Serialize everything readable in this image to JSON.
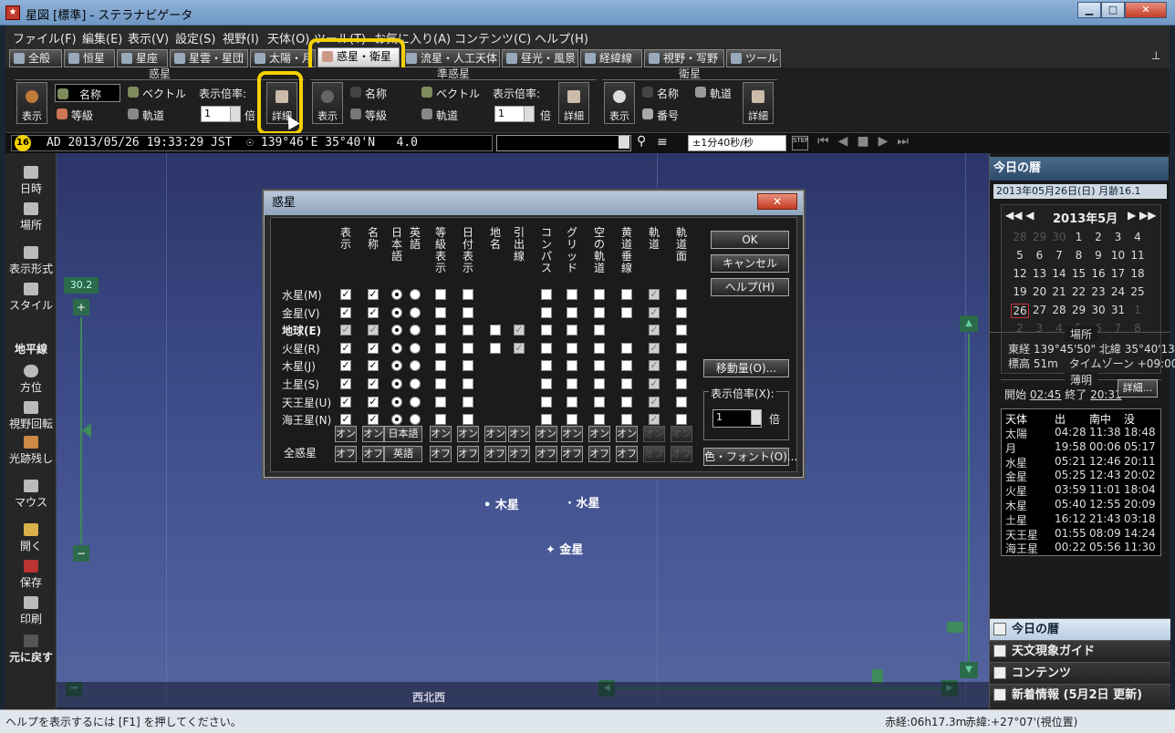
{
  "window": {
    "title": "星図 [標準] - ステラナビゲータ",
    "min": "▁",
    "max": "□",
    "close": "✕"
  },
  "menus": [
    "ファイル(F)",
    "編集(E)",
    "表示(V)",
    "設定(S)",
    "視野(I)",
    "天体(O)",
    "ツール(T)",
    "お気に入り(A)",
    "コンテンツ(C)",
    "ヘルプ(H)"
  ],
  "tabs": [
    "全般",
    "恒星",
    "星座",
    "星雲・星団",
    "太陽・月",
    "惑星・衛星",
    "流星・人工天体",
    "昼光・風景",
    "経緯線",
    "視野・写野",
    "ツール"
  ],
  "toolbar": {
    "planet": {
      "title": "惑星",
      "show": "表示",
      "name": "名称",
      "mag": "等級",
      "vector": "ベクトル",
      "orbit": "軌道",
      "scale_label": "表示倍率:",
      "scale_value": "1",
      "scale_unit": "倍",
      "detail": "詳細"
    },
    "minor": {
      "title": "準惑星",
      "show": "表示",
      "name": "名称",
      "mag": "等級",
      "vector": "ベクトル",
      "orbit": "軌道",
      "scale_label": "表示倍率:",
      "scale_value": "1",
      "scale_unit": "倍",
      "detail": "詳細"
    },
    "satellite": {
      "title": "衛星",
      "show": "表示",
      "name": "名称",
      "orbit": "軌道",
      "number": "番号",
      "detail": "詳細"
    }
  },
  "statusline": {
    "badge": "16",
    "datetime": "AD 2013/05/26 19:33:29 JST",
    "location": "139°46'E 35°40'N",
    "zoom": "4.0",
    "speed": "±1分40秒/秒",
    "step": "STEP"
  },
  "lefttoolbar": [
    "日時",
    "場所",
    "表示形式",
    "スタイル",
    "地平線",
    "方位",
    "視野回転",
    "光跡残し",
    "マウス",
    "開く",
    "保存",
    "印刷",
    "元に戻す"
  ],
  "sky": {
    "fov_value": "30.2",
    "plus": "+",
    "minus": "−",
    "direction": "西北西",
    "planets": [
      "木星",
      "水星",
      "金星"
    ]
  },
  "dialog": {
    "title": "惑星",
    "close": "✕",
    "columns": [
      "表示",
      "名称",
      "日本語",
      "英語",
      "等級表示",
      "日付表示",
      "地名",
      "引出線",
      "コンパス",
      "グリッド",
      "空の軌道",
      "黄道垂線",
      "軌道",
      "軌道面"
    ],
    "rows": [
      "水星(M)",
      "金星(V)",
      "地球(E)",
      "火星(R)",
      "木星(J)",
      "土星(S)",
      "天王星(U)",
      "海王星(N)"
    ],
    "all_label": "全惑星",
    "on": "オン",
    "off": "オフ",
    "on_jp": "日本語",
    "off_en": "英語",
    "ok": "OK",
    "cancel": "キャンセル",
    "help": "ヘルプ(H)",
    "move": "移動量(O)...",
    "scale_group": "表示倍率(X):",
    "scale_value": "1",
    "scale_unit": "倍",
    "colorfont": "色・フォント(O)..."
  },
  "rightpanel": {
    "header": "今日の暦",
    "date": "2013年05月26日(日) 月齢16.1",
    "month": "2013年5月",
    "calendar": [
      [
        "28",
        "29",
        "30",
        "1",
        "2",
        "3",
        "4"
      ],
      [
        "5",
        "6",
        "7",
        "8",
        "9",
        "10",
        "11"
      ],
      [
        "12",
        "13",
        "14",
        "15",
        "16",
        "17",
        "18"
      ],
      [
        "19",
        "20",
        "21",
        "22",
        "23",
        "24",
        "25"
      ],
      [
        "26",
        "27",
        "28",
        "29",
        "30",
        "31",
        "1"
      ],
      [
        "2",
        "3",
        "4",
        "5",
        "6",
        "7",
        "8"
      ]
    ],
    "place_title": "場所",
    "place1": "東経 139°45'50\" 北緯 35°40'13\"",
    "place2": "標高 51m　タイムゾーン +09:00",
    "twilight_title": "薄明",
    "twilight_start_label": "開始",
    "twilight_start": "02:45",
    "twilight_end_label": "終了",
    "twilight_end": "20:31",
    "detail": "詳細...",
    "table_headers": [
      "天体",
      "出",
      "南中",
      "没"
    ],
    "table_rows": [
      [
        "太陽",
        "04:28",
        "11:38",
        "18:48"
      ],
      [
        "月",
        "19:58",
        "00:06",
        "05:17"
      ],
      [
        "水星",
        "05:21",
        "12:46",
        "20:11"
      ],
      [
        "金星",
        "05:25",
        "12:43",
        "20:02"
      ],
      [
        "火星",
        "03:59",
        "11:01",
        "18:04"
      ],
      [
        "木星",
        "05:40",
        "12:55",
        "20:09"
      ],
      [
        "土星",
        "16:12",
        "21:43",
        "03:18"
      ],
      [
        "天王星",
        "01:55",
        "08:09",
        "14:24"
      ],
      [
        "海王星",
        "00:22",
        "05:56",
        "11:30"
      ]
    ],
    "bottom_tabs": [
      "今日の暦",
      "天文現象ガイド",
      "コンテンツ",
      "新着情報 (5月2日 更新)"
    ]
  },
  "statusbar": {
    "help": "ヘルプを表示するには [F1] を押してください。",
    "ra": "赤経:06h17.3m",
    "dec": "赤緯:+27°07'(視位置)"
  }
}
